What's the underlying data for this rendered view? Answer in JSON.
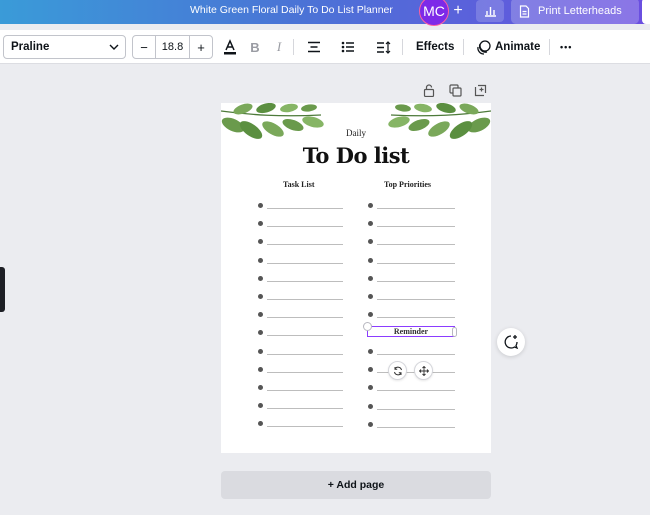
{
  "header": {
    "doc_title": "White Green Floral Daily To Do List Planner",
    "avatar_initials": "MC",
    "add_symbol": "+",
    "print_label": "Print Letterheads",
    "gradient_colors": [
      "#3a9bd8",
      "#4a74d6",
      "#6b4ee0"
    ]
  },
  "toolbar": {
    "font_name": "Praline",
    "font_size": "18.8",
    "minus_symbol": "−",
    "plus_symbol": "+",
    "effects_label": "Effects",
    "animate_label": "Animate",
    "more_symbol": "•••"
  },
  "page": {
    "subtitle": "Daily",
    "title": "To Do list",
    "columns": [
      {
        "heading": "Task List"
      },
      {
        "heading": "Top Priorities"
      }
    ],
    "reminder_label": "Reminder",
    "accent_color": "#8b3dff"
  },
  "add_page_label": "+ Add page"
}
